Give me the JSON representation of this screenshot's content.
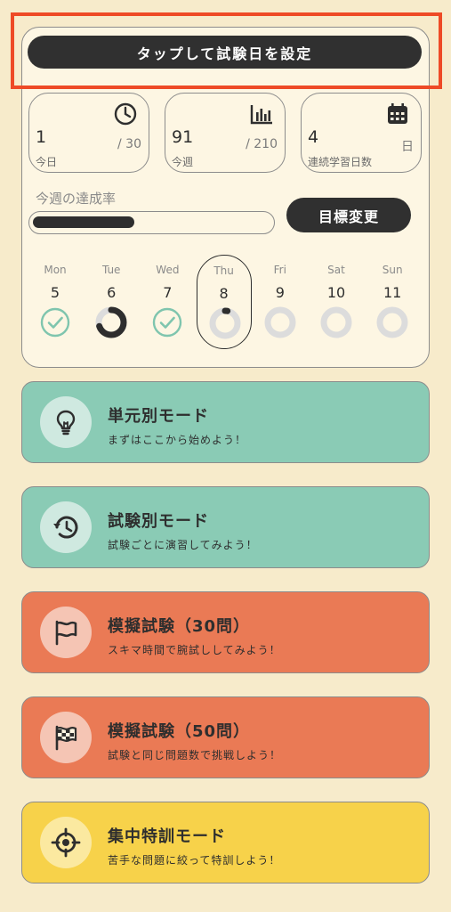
{
  "header": {
    "set_exam_date_label": "タップして試験日を設定"
  },
  "stats": [
    {
      "value": "1",
      "total": "/ 30",
      "label": "今日",
      "icon": "clock-icon"
    },
    {
      "value": "91",
      "total": "/ 210",
      "label": "今週",
      "icon": "bar-chart-icon"
    },
    {
      "value": "4",
      "total": "日",
      "label": "連続学習日数",
      "icon": "calendar-icon"
    }
  ],
  "weekly": {
    "rate_label": "今週の達成率",
    "progress_fraction": 0.43,
    "goal_button_label": "目標変更"
  },
  "days": [
    {
      "dow": "Mon",
      "num": "5",
      "status": "done"
    },
    {
      "dow": "Tue",
      "num": "6",
      "status": "partial",
      "progress": 0.7
    },
    {
      "dow": "Wed",
      "num": "7",
      "status": "done"
    },
    {
      "dow": "Thu",
      "num": "8",
      "status": "today",
      "progress": 0.03
    },
    {
      "dow": "Fri",
      "num": "9",
      "status": "empty"
    },
    {
      "dow": "Sat",
      "num": "10",
      "status": "empty"
    },
    {
      "dow": "Sun",
      "num": "11",
      "status": "empty"
    }
  ],
  "modes": [
    {
      "title": "単元別モード",
      "subtitle": "まずはここから始めよう！",
      "icon": "lightbulb-icon",
      "color": "#8acbb5"
    },
    {
      "title": "試験別モード",
      "subtitle": "試験ごとに演習してみよう！",
      "icon": "history-icon",
      "color": "#8acbb5"
    },
    {
      "title": "模擬試験（30問）",
      "subtitle": "スキマ時間で腕試ししてみよう！",
      "icon": "flag-icon",
      "color": "#ea7a55"
    },
    {
      "title": "模擬試験（50問）",
      "subtitle": "試験と同じ問題数で挑戦しよう！",
      "icon": "checkered-flag-icon",
      "color": "#ea7a55"
    },
    {
      "title": "集中特訓モード",
      "subtitle": "苦手な問題に絞って特訓しよう！",
      "icon": "crosshair-icon",
      "color": "#f7d24a"
    }
  ],
  "colors": {
    "background": "#f7ebcb",
    "card": "#fdf6e3",
    "dark": "#303030",
    "teal": "#8acbb5",
    "orange": "#ea7a55",
    "yellow": "#f7d24a",
    "highlight": "#ee4a26"
  }
}
